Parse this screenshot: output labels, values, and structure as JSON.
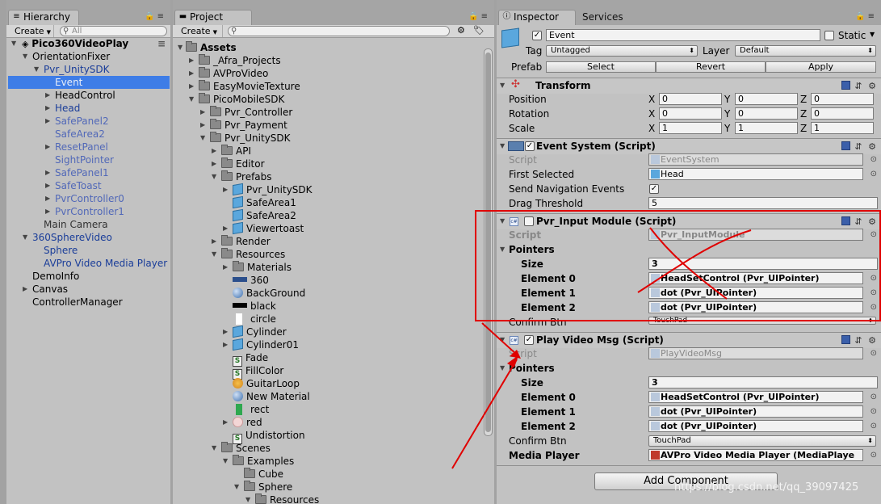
{
  "hierarchy": {
    "tab": "Hierarchy",
    "create": "Create",
    "search_placeholder": "All",
    "scene": "Pico360VideoPlay",
    "items": [
      {
        "label": "OrientationFixer"
      },
      {
        "label": "Pvr_UnitySDK"
      },
      {
        "label": "Event"
      },
      {
        "label": "HeadControl"
      },
      {
        "label": "Head"
      },
      {
        "label": "SafePanel2"
      },
      {
        "label": "SafeArea2"
      },
      {
        "label": "ResetPanel"
      },
      {
        "label": "SightPointer"
      },
      {
        "label": "SafePanel1"
      },
      {
        "label": "SafeToast"
      },
      {
        "label": "PvrController0"
      },
      {
        "label": "PvrController1"
      },
      {
        "label": "Main Camera"
      },
      {
        "label": "360SphereVideo"
      },
      {
        "label": "Sphere"
      },
      {
        "label": "AVPro Video Media Player"
      },
      {
        "label": "DemoInfo"
      },
      {
        "label": "Canvas"
      },
      {
        "label": "ControllerManager"
      }
    ]
  },
  "project": {
    "tab": "Project",
    "create": "Create",
    "root": "Assets",
    "items": [
      {
        "label": "_Afra_Projects",
        "icon": "folder-icon"
      },
      {
        "label": "AVProVideo",
        "icon": "folder-icon"
      },
      {
        "label": "EasyMovieTexture",
        "icon": "folder-icon"
      },
      {
        "label": "PicoMobileSDK",
        "icon": "folder-icon"
      },
      {
        "label": "Pvr_Controller",
        "icon": "folder-icon"
      },
      {
        "label": "Pvr_Payment",
        "icon": "folder-icon"
      },
      {
        "label": "Pvr_UnitySDK",
        "icon": "folder-icon"
      },
      {
        "label": "API",
        "icon": "folder-icon"
      },
      {
        "label": "Editor",
        "icon": "folder-icon"
      },
      {
        "label": "Prefabs",
        "icon": "folder-icon"
      },
      {
        "label": "Pvr_UnitySDK",
        "icon": "prefab-icon"
      },
      {
        "label": "SafeArea1",
        "icon": "prefab-icon"
      },
      {
        "label": "SafeArea2",
        "icon": "prefab-icon"
      },
      {
        "label": "Viewertoast",
        "icon": "prefab-icon"
      },
      {
        "label": "Render",
        "icon": "folder-icon"
      },
      {
        "label": "Resources",
        "icon": "folder-icon"
      },
      {
        "label": "Materials",
        "icon": "folder-icon"
      },
      {
        "label": "360",
        "icon": "texture-icon"
      },
      {
        "label": "BackGround",
        "icon": "material-icon"
      },
      {
        "label": "black",
        "icon": "texture-icon"
      },
      {
        "label": "circle",
        "icon": "texture-icon"
      },
      {
        "label": "Cylinder",
        "icon": "prefab-icon"
      },
      {
        "label": "Cylinder01",
        "icon": "prefab-icon"
      },
      {
        "label": "Fade",
        "icon": "shader-icon"
      },
      {
        "label": "FillColor",
        "icon": "shader-icon"
      },
      {
        "label": "GuitarLoop",
        "icon": "audio-icon"
      },
      {
        "label": "New Material",
        "icon": "material-icon"
      },
      {
        "label": "rect",
        "icon": "texture-icon"
      },
      {
        "label": "red",
        "icon": "texture-icon"
      },
      {
        "label": "Undistortion",
        "icon": "shader-icon"
      },
      {
        "label": "Scenes",
        "icon": "folder-icon"
      },
      {
        "label": "Examples",
        "icon": "folder-icon"
      },
      {
        "label": "Cube",
        "icon": "folder-icon"
      },
      {
        "label": "Sphere",
        "icon": "folder-icon"
      },
      {
        "label": "Resources",
        "icon": "folder-icon"
      }
    ]
  },
  "inspector": {
    "tab": "Inspector",
    "tab2": "Services",
    "object_name": "Event",
    "static_label": "Static",
    "tag_label": "Tag",
    "tag_value": "Untagged",
    "layer_label": "Layer",
    "layer_value": "Default",
    "prefab_label": "Prefab",
    "prefab_select": "Select",
    "prefab_revert": "Revert",
    "prefab_apply": "Apply",
    "transform": {
      "title": "Transform",
      "position_label": "Position",
      "rotation_label": "Rotation",
      "scale_label": "Scale",
      "x": "X",
      "y": "Y",
      "z": "Z",
      "position": [
        "0",
        "0",
        "0"
      ],
      "rotation": [
        "0",
        "0",
        "0"
      ],
      "scale": [
        "1",
        "1",
        "1"
      ]
    },
    "event_system": {
      "title": "Event System (Script)",
      "script_label": "Script",
      "script_value": "EventSystem",
      "first_selected_label": "First Selected",
      "first_selected_value": "Head",
      "send_nav_label": "Send Navigation Events",
      "drag_label": "Drag Threshold",
      "drag_value": "5"
    },
    "input_module": {
      "title": "Pvr_Input Module (Script)",
      "script_label": "Script",
      "script_value": "Pvr_InputModule",
      "pointers_label": "Pointers",
      "size_label": "Size",
      "size_value": "3",
      "elements": [
        {
          "label": "Element 0",
          "value": "HeadSetControl (Pvr_UIPointer)"
        },
        {
          "label": "Element 1",
          "value": "dot (Pvr_UIPointer)"
        },
        {
          "label": "Element 2",
          "value": "dot (Pvr_UIPointer)"
        }
      ],
      "confirm_label": "Confirm Btn",
      "confirm_value": "TouchPad"
    },
    "play_video": {
      "title": "Play Video Msg (Script)",
      "script_label": "Script",
      "script_value": "PlayVideoMsg",
      "pointers_label": "Pointers",
      "size_label": "Size",
      "size_value": "3",
      "elements": [
        {
          "label": "Element 0",
          "value": "HeadSetControl (Pvr_UIPointer)"
        },
        {
          "label": "Element 1",
          "value": "dot (Pvr_UIPointer)"
        },
        {
          "label": "Element 2",
          "value": "dot (Pvr_UIPointer)"
        }
      ],
      "confirm_label": "Confirm Btn",
      "confirm_value": "TouchPad",
      "media_label": "Media Player",
      "media_value": "AVPro Video Media Player (MediaPlaye"
    },
    "add_component": "Add Component"
  },
  "watermark": "https://blog.csdn.net/qq_39097425",
  "colors": {
    "selection": "#3e7de7",
    "prefab_blue": "#1a3d99",
    "annotation_red": "#e00000"
  }
}
